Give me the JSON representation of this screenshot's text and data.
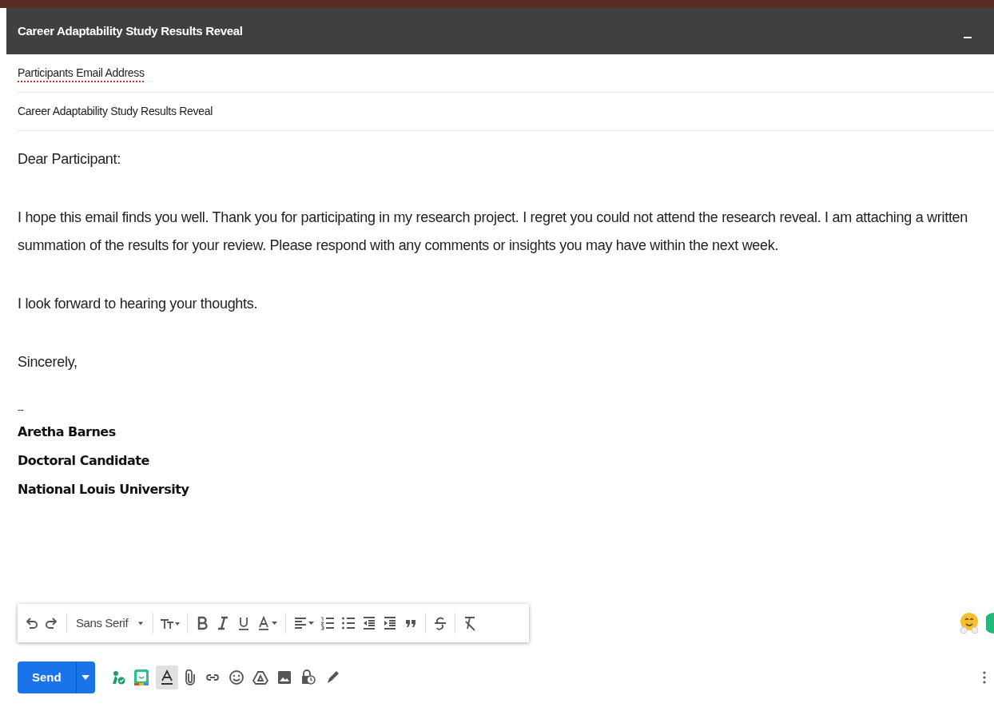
{
  "window": {
    "title": "Career Adaptability Study Results Reveal"
  },
  "recipient": {
    "value": "Participants Email Address",
    "spellcheck_flagged": true
  },
  "subject": {
    "value": "Career Adaptability Study Results Reveal"
  },
  "body": {
    "paragraphs": [
      "Dear Participant:",
      "I hope this email finds you well. Thank you for participating in my research project. I regret you could not attend the research reveal. I am attaching a written summation of the results for your review. Please respond with any comments or insights you may have within the next week.",
      "I look forward to hearing your thoughts.",
      "Sincerely,"
    ],
    "signature_separator": "--",
    "signature": [
      "Aretha Barnes",
      "Doctoral Candidate",
      "National Louis University"
    ]
  },
  "format_toolbar": {
    "font": "Sans Serif"
  },
  "bottom_bar": {
    "send_label": "Send",
    "formatting_toggle": {
      "selected": true
    }
  }
}
